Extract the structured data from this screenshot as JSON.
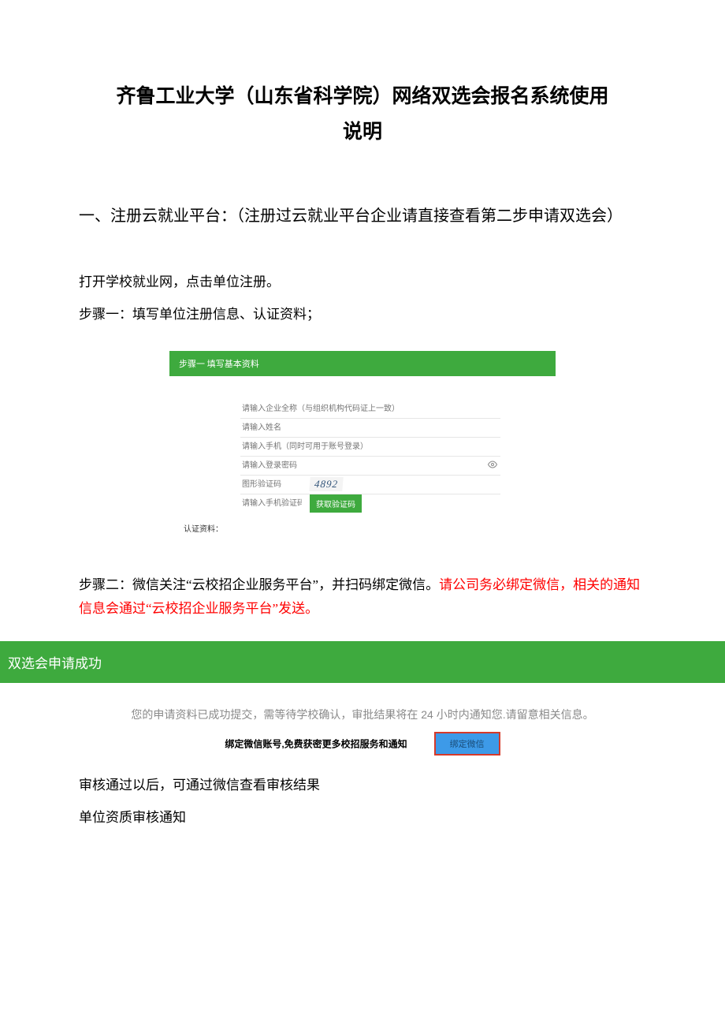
{
  "title_line1": "齐鲁工业大学（山东省科学院）网络双选会报名系统使用",
  "title_line2": "说明",
  "section1_heading": "一、注册云就业平台：（注册过云就业平台企业请直接查看第二步申请双选会）",
  "intro_line1": "打开学校就业网，点击单位注册。",
  "intro_line2": "步骤一：填写单位注册信息、认证资料；",
  "form": {
    "header": "步骤一   填写基本资料",
    "company_placeholder": "请输入企业全称（与组织机构代码证上一致）",
    "name_placeholder": "请输入姓名",
    "phone_placeholder": "请输入手机（同时可用于账号登录）",
    "password_placeholder": "请输入登录密码",
    "captcha_placeholder": "图形验证码",
    "captcha_value": "4892",
    "sms_placeholder": "请输入手机验证码",
    "get_code_btn": "获取验证码",
    "auth_label": "认证资料："
  },
  "step2": {
    "prefix": "步骤二：微信关注“云校招企业服务平台”，并扫码绑定微信。",
    "red": "请公司务必绑定微信，相关的通知信息会通过“云校招企业服务平台”发送。"
  },
  "success": {
    "banner": "双选会申请成功",
    "message": "您的申请资料已成功提交，需等待学校确认，审批结果将在 24 小时内通知您.请留意相关信息。",
    "bind_label": "绑定微信账号,免费获密更多校招服务和通知",
    "bind_btn": "绑定微信"
  },
  "after1": "审核通过以后，可通过微信查看审核结果",
  "after2": "单位资质审核通知"
}
